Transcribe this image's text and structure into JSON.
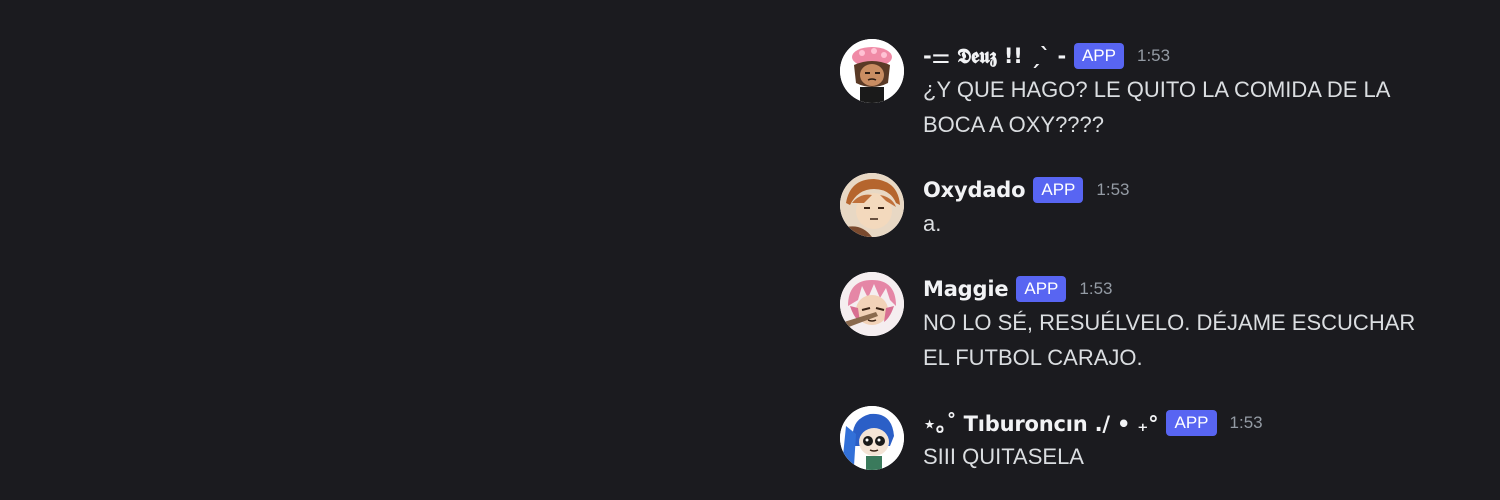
{
  "messages": [
    {
      "username": "-⚌ 𝕯𝖊𝖚𝖟 !! ˏˋ -",
      "badge": "APP",
      "time": "1:53",
      "text": "¿Y QUE HAGO? LE QUITO LA COMIDA DE LA BOCA A OXY????",
      "avatar": "avatar-deuz"
    },
    {
      "username": "Oxydado",
      "badge": "APP",
      "time": "1:53",
      "text": "a.",
      "avatar": "avatar-oxydado"
    },
    {
      "username": "Maggie",
      "badge": "APP",
      "time": "1:53",
      "text": "NO LO SÉ, RESUÉLVELO. DÉJAME ESCUCHAR EL FUTBOL CARAJO.",
      "avatar": "avatar-maggie"
    },
    {
      "username": "⋆｡˚ Tıburoncın ./ • ₊°",
      "badge": "APP",
      "time": "1:53",
      "text": "SIII QUITASELA",
      "avatar": "avatar-tiburoncin"
    }
  ],
  "colors": {
    "background": "#1b1b1f",
    "username": "#f2f3f5",
    "message_text": "#dbdee1",
    "timestamp": "#949ba4",
    "app_badge": "#5865f2"
  }
}
